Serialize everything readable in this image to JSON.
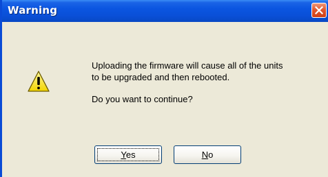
{
  "window": {
    "title": "Warning",
    "close_icon": "close-icon",
    "titlebar_color": "#0a50d8",
    "close_color": "#e2582f"
  },
  "message": {
    "icon": "warning-icon",
    "line1": "Uploading the firmware will cause all of the units",
    "line2": "to be upgraded and then rebooted.",
    "question": "Do you want to continue?"
  },
  "buttons": {
    "yes_mnemonic": "Y",
    "yes_rest": "es",
    "no_mnemonic": "N",
    "no_rest": "o"
  }
}
